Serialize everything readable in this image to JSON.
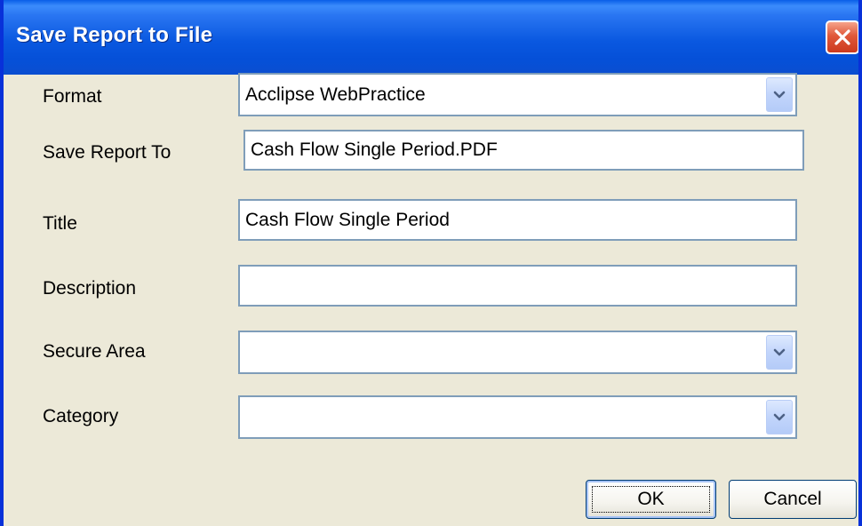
{
  "window": {
    "title": "Save Report to File"
  },
  "form": {
    "format": {
      "label": "Format",
      "value": "Acclipse WebPractice"
    },
    "save_report_to": {
      "label": "Save Report To",
      "value": "Cash Flow Single Period.PDF"
    },
    "title": {
      "label": "Title",
      "value": "Cash Flow Single Period"
    },
    "description": {
      "label": "Description",
      "value": ""
    },
    "secure_area": {
      "label": "Secure Area",
      "value": ""
    },
    "category": {
      "label": "Category",
      "value": ""
    }
  },
  "buttons": {
    "ok": "OK",
    "cancel": "Cancel"
  },
  "icons": {
    "close": "close-icon",
    "dropdown": "chevron-down-icon"
  },
  "colors": {
    "titlebar": "#0a58e0",
    "close_button": "#e0583a",
    "field_border": "#7f9db9",
    "dialog_background": "#ece9d8"
  }
}
